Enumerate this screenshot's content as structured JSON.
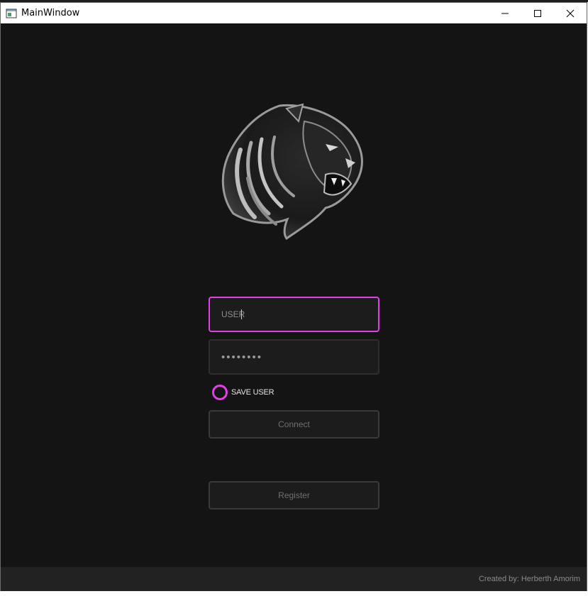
{
  "window": {
    "title": "MainWindow"
  },
  "login": {
    "user_placeholder": "USER",
    "password_masked": "••••••••",
    "save_user_label": "SAVE USER",
    "connect_label": "Connect",
    "register_label": "Register"
  },
  "footer": {
    "credit": "Created by: Herberth Amorim"
  },
  "colors": {
    "accent": "#e040e6",
    "background": "#141414",
    "footer": "#222222"
  },
  "icons": [
    "app-icon",
    "minimize-icon",
    "maximize-icon",
    "close-icon",
    "panther-logo",
    "radio-icon"
  ]
}
